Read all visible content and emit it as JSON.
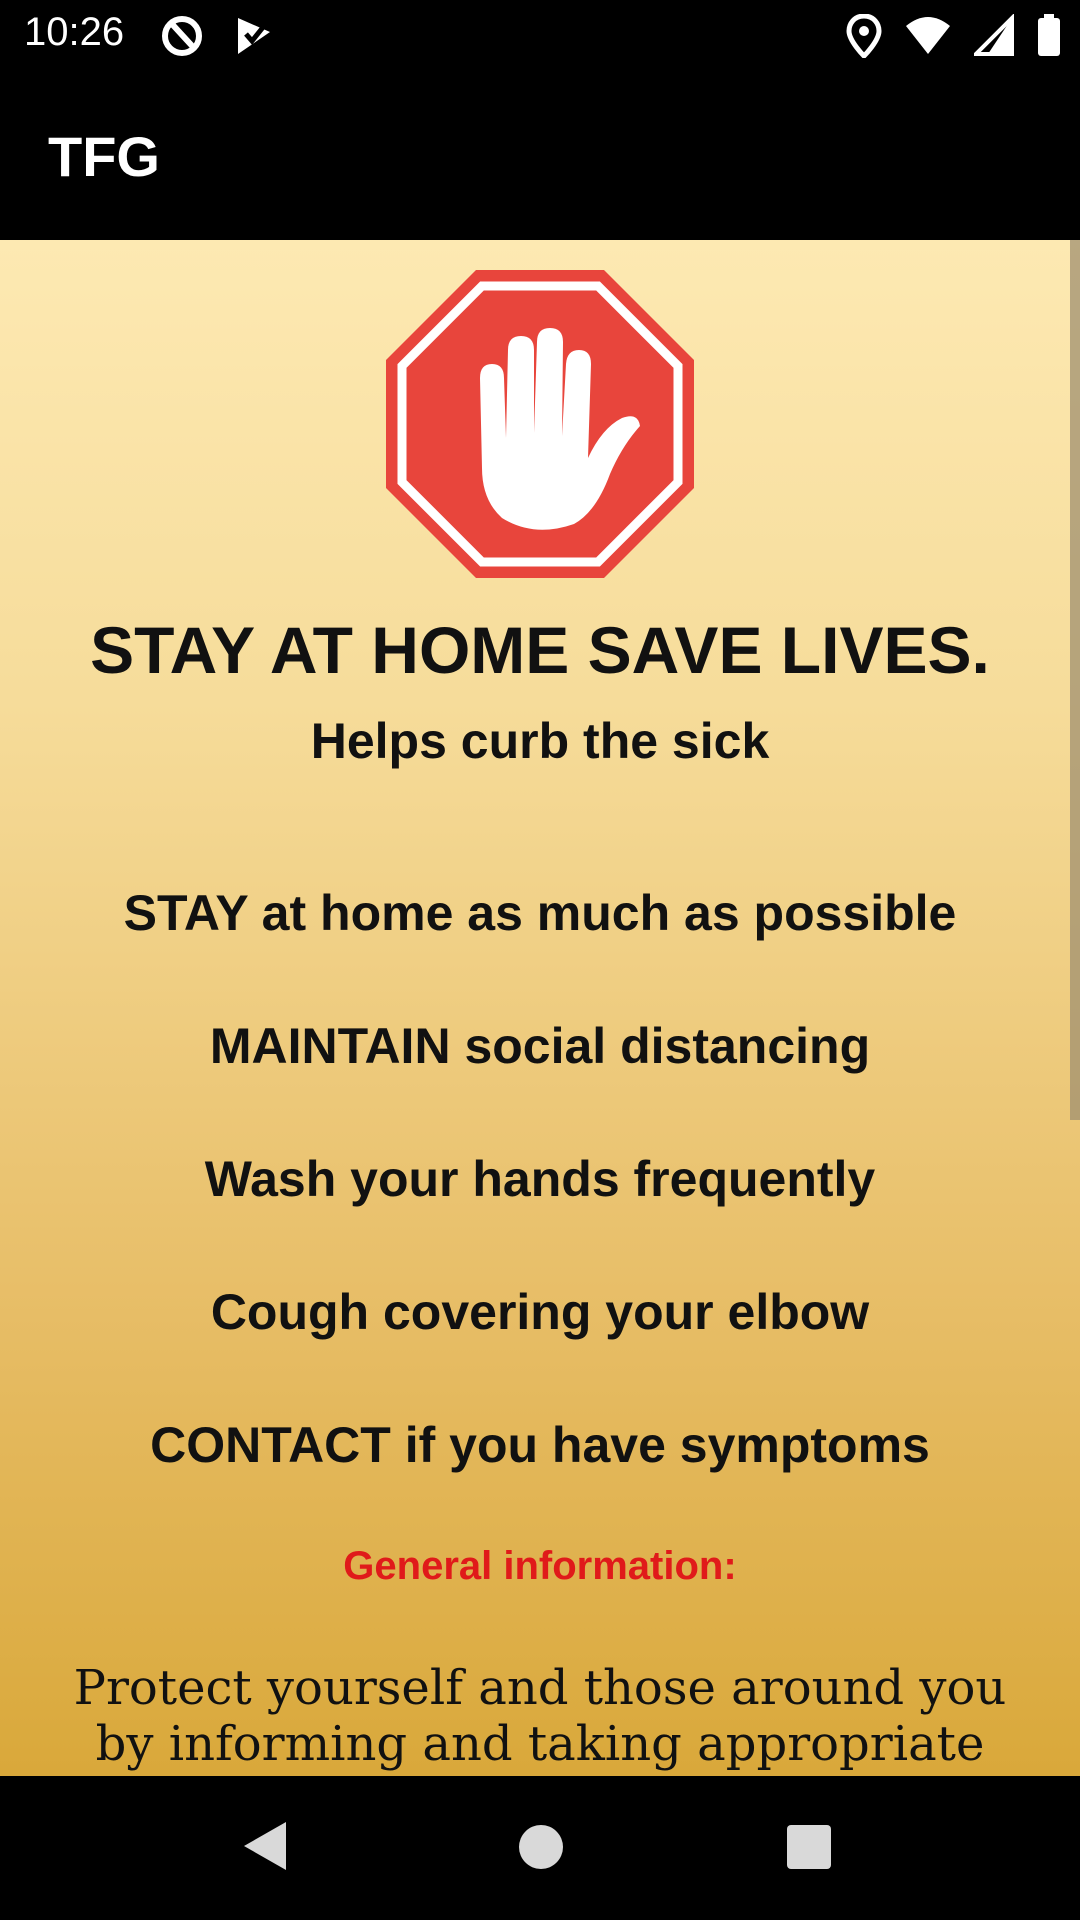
{
  "status_bar": {
    "time": "10:26",
    "left_icons": [
      "at-sign-icon",
      "checkmark-icon"
    ],
    "right_icons": [
      "location-icon",
      "wifi-icon",
      "cell-signal-icon",
      "battery-icon"
    ]
  },
  "app_bar": {
    "title": "TFG"
  },
  "content": {
    "sign_icon": "stop-hand-icon",
    "colors": {
      "sign_red": "#e8453c",
      "heading_red": "#e01a1a"
    },
    "headline": "STAY AT HOME SAVE LIVES.",
    "subhead": "Helps curb the sick",
    "tips": [
      "STAY at home as much as possible",
      "MAINTAIN social distancing",
      "Wash your hands frequently",
      "Cough covering your elbow",
      "CONTACT if you have symptoms"
    ],
    "general_title": "General information:",
    "general_body": "Protect yourself and those around you by informing and taking appropriate"
  },
  "nav_bar": {
    "buttons": [
      "back-icon",
      "home-icon",
      "recents-icon"
    ]
  }
}
